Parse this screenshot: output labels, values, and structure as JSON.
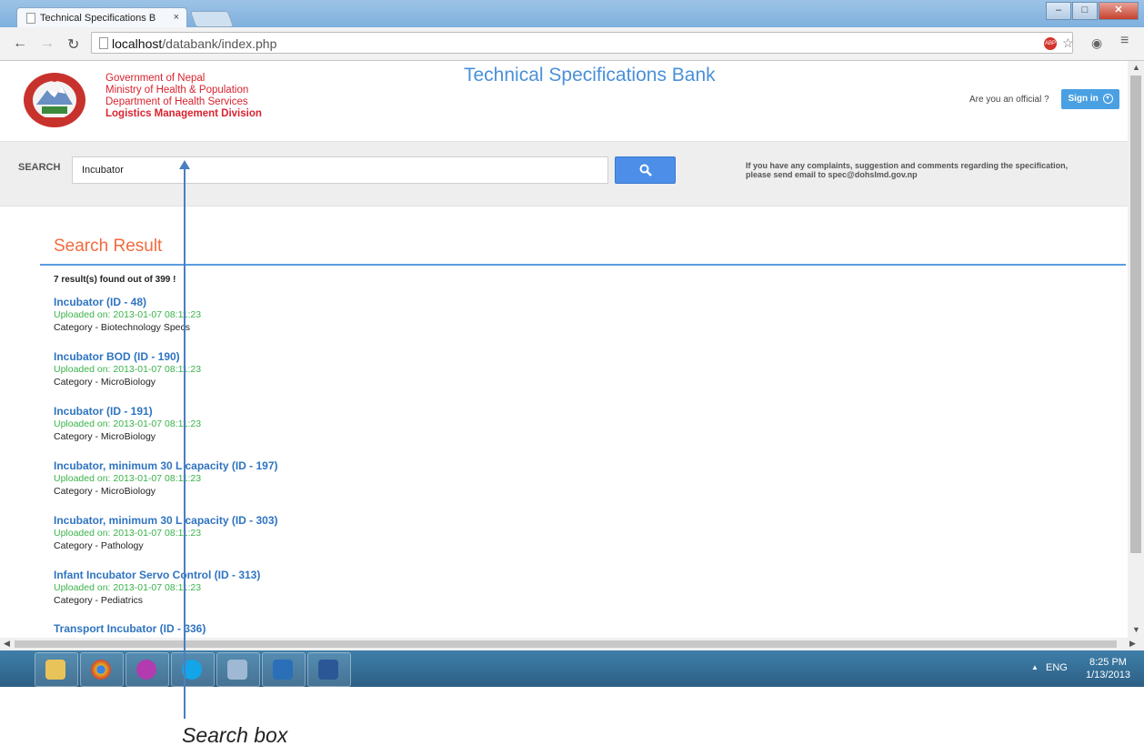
{
  "browser": {
    "tab_title": "Technical Specifications B",
    "tab_close": "×",
    "url_prefix": "localhost",
    "url_path": "/databank/index.php",
    "abp_badge": "ABP"
  },
  "header": {
    "gov_line1": "Government of Nepal",
    "gov_line2": "Ministry of Health & Population",
    "gov_line3": "Department of Health Services",
    "gov_line4": "Logistics Management Division",
    "site_title": "Technical Specifications Bank",
    "official_prompt": "Are you an official ?",
    "sign_in": "Sign in"
  },
  "search": {
    "label": "SEARCH",
    "value": "Incubator",
    "note_line1": "If you have any complaints, suggestion and comments regarding the specification,",
    "note_line2": "please send email to spec@dohslmd.gov.np"
  },
  "results": {
    "heading": "Search Result",
    "count": "7 result(s) found out of 399 !",
    "items": [
      {
        "title": "Incubator  (ID - 48)",
        "date": "Uploaded on: 2013-01-07 08:11:23",
        "category": "Category -  Biotechnology Specs"
      },
      {
        "title": "Incubator BOD  (ID - 190)",
        "date": "Uploaded on: 2013-01-07 08:11:23",
        "category": "Category -  MicroBiology"
      },
      {
        "title": "Incubator  (ID - 191)",
        "date": "Uploaded on: 2013-01-07 08:11:23",
        "category": "Category -  MicroBiology"
      },
      {
        "title": "Incubator, minimum 30 L capacity  (ID - 197)",
        "date": "Uploaded on: 2013-01-07 08:11:23",
        "category": "Category -  MicroBiology"
      },
      {
        "title": "Incubator, minimum 30 L capacity  (ID - 303)",
        "date": "Uploaded on: 2013-01-07 08:11:23",
        "category": "Category -  Pathology"
      },
      {
        "title": "Infant Incubator Servo Control  (ID - 313)",
        "date": "Uploaded on: 2013-01-07 08:11:23",
        "category": "Category -  Pediatrics"
      },
      {
        "title": "Transport Incubator  (ID - 336)",
        "date": "",
        "category": ""
      }
    ]
  },
  "taskbar": {
    "lang": "ENG",
    "time": "8:25 PM",
    "date": "1/13/2013"
  },
  "annotation": {
    "caption": "Search box"
  },
  "colors": {
    "accent": "#4a90d9",
    "heading_orange": "#f26a3d",
    "link_blue": "#2f74c0",
    "date_green": "#3ab34a",
    "gov_red": "#d9232f"
  }
}
